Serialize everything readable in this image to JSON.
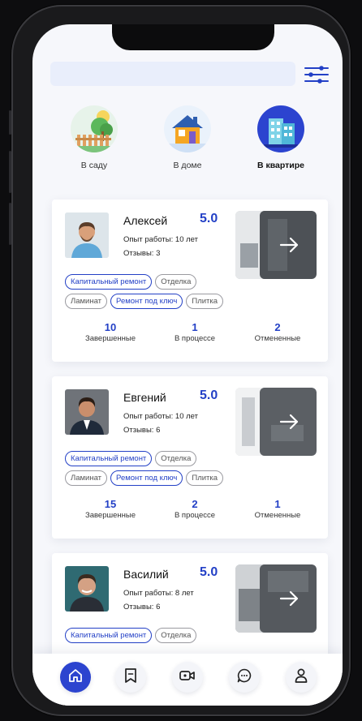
{
  "search": {
    "placeholder": ""
  },
  "colors": {
    "accent": "#2340c6",
    "active_nav": "#2c44cf",
    "search_bg": "#e9eefb"
  },
  "categories": [
    {
      "label": "В саду",
      "icon": "garden-icon",
      "active": false
    },
    {
      "label": "В доме",
      "icon": "house-icon",
      "active": false
    },
    {
      "label": "В квартире",
      "icon": "apartment-building-icon",
      "active": true
    }
  ],
  "specialists": [
    {
      "name": "Алексей",
      "rating": "5.0",
      "experience_label": "Опыт работы:",
      "experience_value": "10 лет",
      "reviews_label": "Отзывы:",
      "reviews_value": "3",
      "tags_row1": [
        {
          "label": "Капитальный ремонт",
          "highlight": true
        },
        {
          "label": "Отделка",
          "highlight": false
        }
      ],
      "tags_row2": [
        {
          "label": "Ламинат",
          "highlight": false
        },
        {
          "label": "Ремонт под ключ",
          "highlight": true
        },
        {
          "label": "Плитка",
          "highlight": false
        }
      ],
      "stats": [
        {
          "value": "10",
          "label": "Завершенные"
        },
        {
          "value": "1",
          "label": "В процессе"
        },
        {
          "value": "2",
          "label": "Отмененные"
        }
      ]
    },
    {
      "name": "Евгений",
      "rating": "5.0",
      "experience_label": "Опыт работы:",
      "experience_value": "10 лет",
      "reviews_label": "Отзывы:",
      "reviews_value": "6",
      "tags_row1": [
        {
          "label": "Капитальный ремонт",
          "highlight": true
        },
        {
          "label": "Отделка",
          "highlight": false
        }
      ],
      "tags_row2": [
        {
          "label": "Ламинат",
          "highlight": false
        },
        {
          "label": "Ремонт под ключ",
          "highlight": true
        },
        {
          "label": "Плитка",
          "highlight": false
        }
      ],
      "stats": [
        {
          "value": "15",
          "label": "Завершенные"
        },
        {
          "value": "2",
          "label": "В процессе"
        },
        {
          "value": "1",
          "label": "Отмененные"
        }
      ]
    },
    {
      "name": "Василий",
      "rating": "5.0",
      "experience_label": "Опыт работы:",
      "experience_value": "8 лет",
      "reviews_label": "Отзывы:",
      "reviews_value": "6",
      "tags_row1": [
        {
          "label": "Капитальный ремонт",
          "highlight": true
        },
        {
          "label": "Отделка",
          "highlight": false
        }
      ],
      "tags_row2": [],
      "stats": []
    }
  ],
  "bottom_nav": [
    {
      "icon": "home-icon",
      "active": true
    },
    {
      "icon": "bookmark-icon",
      "active": false
    },
    {
      "icon": "video-call-icon",
      "active": false
    },
    {
      "icon": "chat-icon",
      "active": false
    },
    {
      "icon": "profile-icon",
      "active": false
    }
  ]
}
